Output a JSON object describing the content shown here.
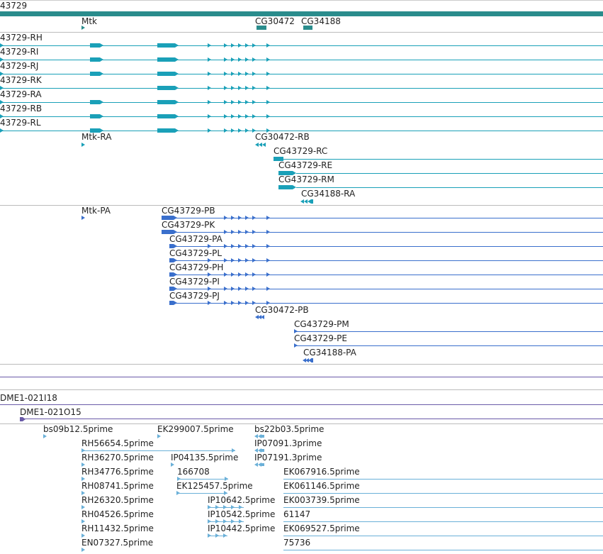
{
  "gene_track": {
    "header_label": "43729",
    "gene_labels": [
      {
        "id": "mtk",
        "text": "Mtk"
      },
      {
        "id": "cg30472",
        "text": "CG30472"
      },
      {
        "id": "cg34188",
        "text": "CG34188"
      }
    ],
    "transcripts_a": [
      {
        "id": "rh",
        "text": "43729-RH"
      },
      {
        "id": "ri",
        "text": "43729-RI"
      },
      {
        "id": "rj",
        "text": "43729-RJ"
      },
      {
        "id": "rk",
        "text": "43729-RK"
      },
      {
        "id": "ra",
        "text": "43729-RA"
      },
      {
        "id": "rb",
        "text": "43729-RB"
      },
      {
        "id": "rl",
        "text": "43729-RL"
      }
    ],
    "transcripts_b": [
      {
        "id": "mtk-ra",
        "text": "Mtk-RA"
      },
      {
        "id": "cg30472-rb",
        "text": "CG30472-RB"
      },
      {
        "id": "cg43729-rc",
        "text": "CG43729-RC"
      },
      {
        "id": "cg43729-re",
        "text": "CG43729-RE"
      },
      {
        "id": "cg43729-rm",
        "text": "CG43729-RM"
      },
      {
        "id": "cg34188-ra",
        "text": "CG34188-RA"
      }
    ]
  },
  "protein_track": {
    "labels": [
      {
        "id": "mtk-pa",
        "text": "Mtk-PA"
      },
      {
        "id": "cg43729-pb",
        "text": "CG43729-PB"
      },
      {
        "id": "cg43729-pk",
        "text": "CG43729-PK"
      },
      {
        "id": "cg43729-pa",
        "text": "CG43729-PA"
      },
      {
        "id": "cg43729-pl",
        "text": "CG43729-PL"
      },
      {
        "id": "cg43729-ph",
        "text": "CG43729-PH"
      },
      {
        "id": "cg43729-pi",
        "text": "CG43729-PI"
      },
      {
        "id": "cg43729-pj",
        "text": "CG43729-PJ"
      },
      {
        "id": "cg30472-pb",
        "text": "CG30472-PB"
      },
      {
        "id": "cg43729-pm",
        "text": "CG43729-PM"
      },
      {
        "id": "cg43729-pe",
        "text": "CG43729-PE"
      },
      {
        "id": "cg34188-pa",
        "text": "CG34188-PA"
      }
    ]
  },
  "clone_track": {
    "labels": [
      {
        "id": "dme1-021i18",
        "text": "DME1-021I18"
      },
      {
        "id": "dme1-021o15",
        "text": "DME1-021O15"
      }
    ]
  },
  "est_track": {
    "labels": [
      {
        "id": "bs09b12",
        "text": "bs09b12.5prime"
      },
      {
        "id": "ek299007",
        "text": "EK299007.5prime"
      },
      {
        "id": "bs22b03",
        "text": "bs22b03.5prime"
      },
      {
        "id": "rh56654",
        "text": "RH56654.5prime"
      },
      {
        "id": "ip07091",
        "text": "IP07091.3prime"
      },
      {
        "id": "rh36270",
        "text": "RH36270.5prime"
      },
      {
        "id": "ip04135",
        "text": "IP04135.5prime"
      },
      {
        "id": "ip07191",
        "text": "IP07191.3prime"
      },
      {
        "id": "rh34776",
        "text": "RH34776.5prime"
      },
      {
        "id": "n166708",
        "text": "166708"
      },
      {
        "id": "ek067916",
        "text": "EK067916.5prime"
      },
      {
        "id": "rh08741",
        "text": "RH08741.5prime"
      },
      {
        "id": "ek125457",
        "text": "EK125457.5prime"
      },
      {
        "id": "ek061146",
        "text": "EK061146.5prime"
      },
      {
        "id": "rh26320",
        "text": "RH26320.5prime"
      },
      {
        "id": "ip10642",
        "text": "IP10642.5prime"
      },
      {
        "id": "ek003739",
        "text": "EK003739.5prime"
      },
      {
        "id": "rh04526",
        "text": "RH04526.5prime"
      },
      {
        "id": "ip10542",
        "text": "IP10542.5prime"
      },
      {
        "id": "n61147",
        "text": "61147"
      },
      {
        "id": "rh11432",
        "text": "RH11432.5prime"
      },
      {
        "id": "ip10442",
        "text": "IP10442.5prime"
      },
      {
        "id": "ek069527",
        "text": "EK069527.5prime"
      },
      {
        "id": "en07327",
        "text": "EN07327.5prime"
      },
      {
        "id": "n75736",
        "text": "75736"
      }
    ]
  },
  "colors": {
    "gene": "#2a8c8c",
    "transcript": "#1aa0b8",
    "protein": "#3a6fcc",
    "clone": "#6a5aa8",
    "est": "#6ab0d8",
    "separator": "#bbbbbb"
  }
}
